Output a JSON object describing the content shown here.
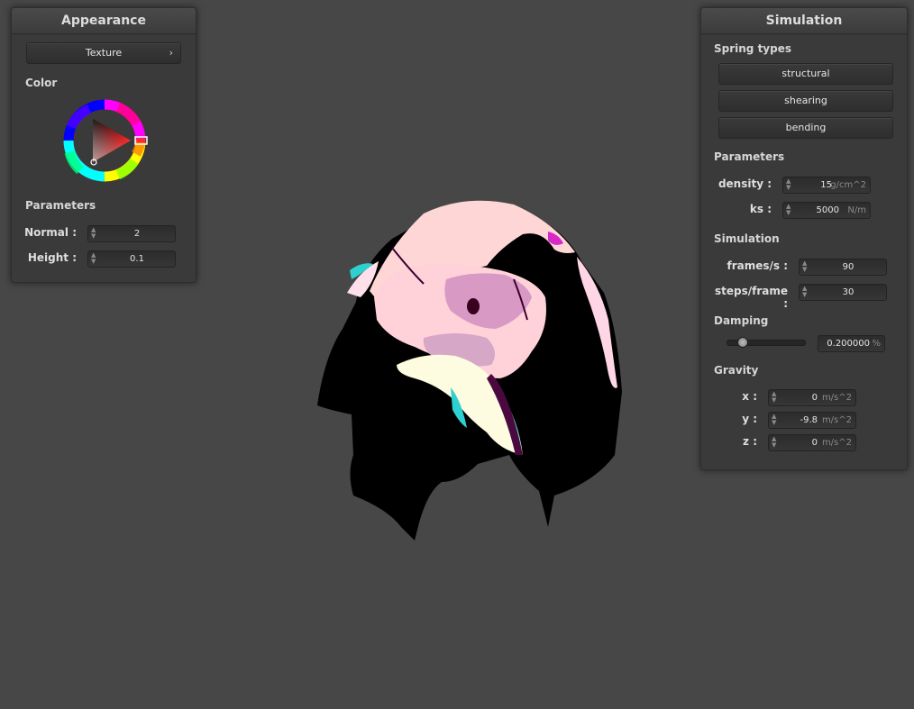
{
  "appearance": {
    "title": "Appearance",
    "texture_button": "Texture",
    "color_label": "Color",
    "params_label": "Parameters",
    "normal_label": "Normal :",
    "normal_value": "2",
    "height_label": "Height :",
    "height_value": "0.1",
    "selected_color": "#ff2a2a"
  },
  "simulation": {
    "title": "Simulation",
    "spring_types_label": "Spring types",
    "spring_buttons": [
      "structural",
      "shearing",
      "bending"
    ],
    "params_label": "Parameters",
    "density_label": "density :",
    "density_value": "15",
    "density_unit": "g/cm^2",
    "ks_label": "ks :",
    "ks_value": "5000",
    "ks_unit": "N/m",
    "sim_label": "Simulation",
    "fps_label": "frames/s :",
    "fps_value": "90",
    "steps_label": "steps/frame :",
    "steps_value": "30",
    "damping_label": "Damping",
    "damping_value": "0.200000",
    "damping_unit": "%",
    "damping_fraction": 0.2,
    "gravity_label": "Gravity",
    "gx_label": "x :",
    "gx_value": "0",
    "gy_label": "y :",
    "gy_value": "-9.8",
    "gz_label": "z :",
    "gz_value": "0",
    "gravity_unit": "m/s^2"
  }
}
